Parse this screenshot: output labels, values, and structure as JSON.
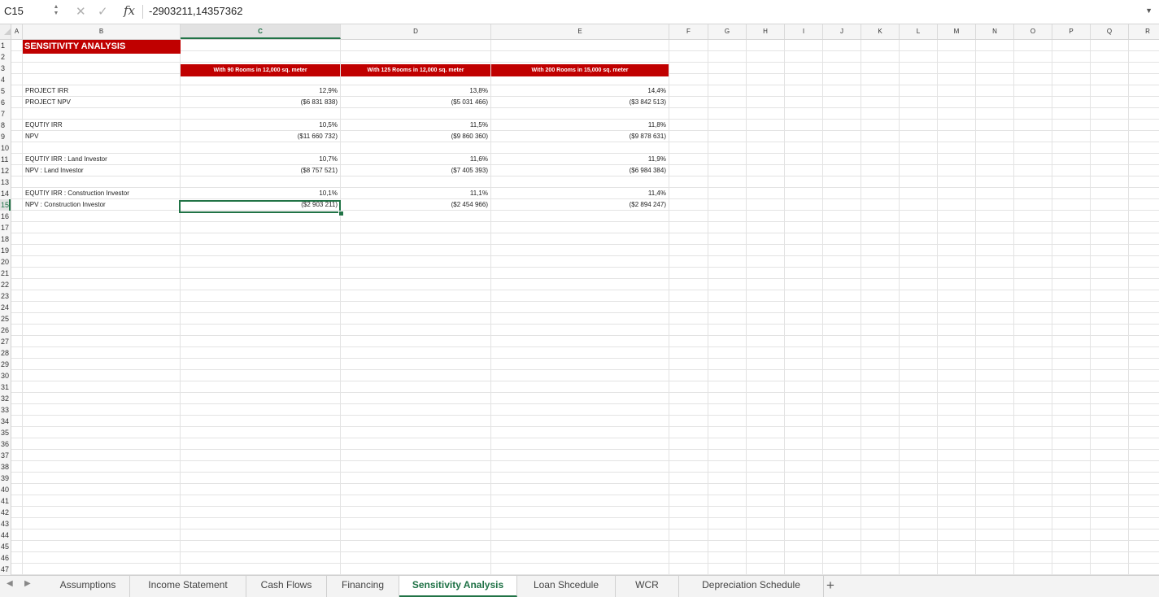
{
  "formula_bar": {
    "name_box": "C15",
    "cancel_icon": "✕",
    "confirm_icon": "✓",
    "fx_label": "fx",
    "formula": "-2903211,14357362"
  },
  "columns": [
    "A",
    "B",
    "C",
    "D",
    "E",
    "F",
    "G",
    "H",
    "I",
    "J",
    "K",
    "L",
    "M",
    "N",
    "O",
    "P",
    "Q",
    "R"
  ],
  "selected_column": "C",
  "rows": [
    "1",
    "2",
    "3",
    "4",
    "5",
    "6",
    "7",
    "8",
    "9",
    "10",
    "11",
    "12",
    "13",
    "14",
    "15",
    "16",
    "17",
    "18",
    "19",
    "20",
    "21",
    "22",
    "23",
    "24",
    "25",
    "26",
    "27",
    "28",
    "29",
    "30",
    "31",
    "32",
    "33",
    "34",
    "35",
    "36",
    "37",
    "38",
    "39",
    "40",
    "41",
    "42",
    "43",
    "44",
    "45",
    "46",
    "47"
  ],
  "selected_row": "15",
  "sheet": {
    "title": "SENSITIVITY ANALYSIS",
    "headers": [
      "With 90 Rooms in 12,000 sq. meter",
      "With 125 Rooms in 12,000 sq. meter",
      "With 200 Rooms in 15,000 sq. meter"
    ],
    "metrics": [
      {
        "label": "PROJECT IRR",
        "values": [
          "12,9%",
          "13,8%",
          "14,4%"
        ]
      },
      {
        "label": "PROJECT NPV",
        "values": [
          "($6 831 838)",
          "($5 031 466)",
          "($3 842 513)"
        ]
      },
      {
        "label": "EQUTIY IRR",
        "values": [
          "10,5%",
          "11,5%",
          "11,8%"
        ]
      },
      {
        "label": "NPV",
        "values": [
          "($11 660 732)",
          "($9 860 360)",
          "($9 878 631)"
        ]
      },
      {
        "label": "EQUTIY IRR : Land Investor",
        "values": [
          "10,7%",
          "11,6%",
          "11,9%"
        ]
      },
      {
        "label": "NPV : Land Investor",
        "values": [
          "($8 757 521)",
          "($7 405 393)",
          "($6 984 384)"
        ]
      },
      {
        "label": "EQUTIY IRR : Construction Investor",
        "values": [
          "10,1%",
          "11,1%",
          "11,4%"
        ]
      },
      {
        "label": "NPV : Construction Investor",
        "values": [
          "($2 903 211)",
          "($2 454 966)",
          "($2 894 247)"
        ]
      }
    ]
  },
  "tabs": [
    "Assumptions",
    "Income Statement",
    "Cash Flows",
    "Financing",
    "Sensitivity Analysis",
    "Loan Shcedule",
    "WCR",
    "Depreciation Schedule"
  ],
  "active_tab": "Sensitivity Analysis",
  "add_sheet_label": "+",
  "colors": {
    "accent_green": "#217346",
    "title_red": "#c00000"
  }
}
